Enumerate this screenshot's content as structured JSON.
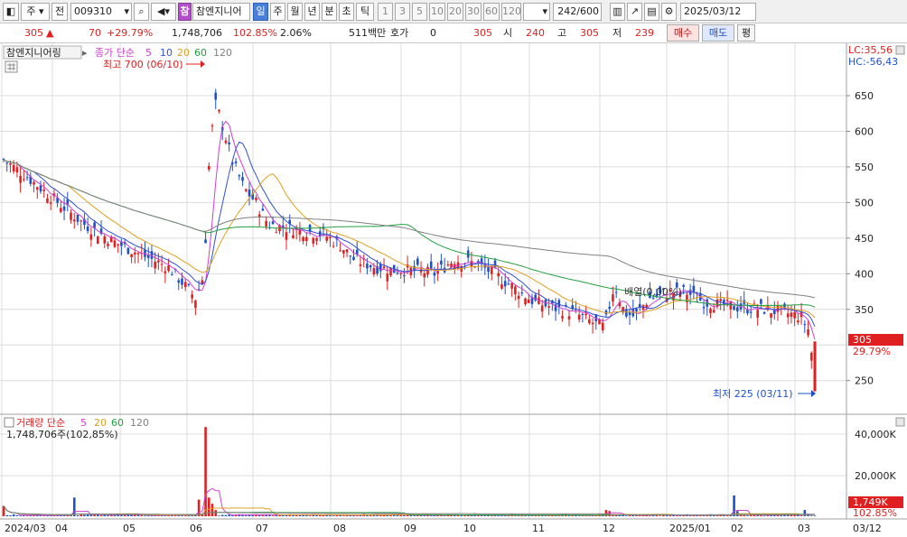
{
  "toolbar": {
    "type_label": "주",
    "jeon_label": "전",
    "code_value": "009310",
    "stock_name": "참엔지니어",
    "logo_char": "참",
    "periods": [
      "일",
      "주",
      "월",
      "년",
      "분",
      "초",
      "틱"
    ],
    "selected_period": "일",
    "counts": [
      "1",
      "3",
      "5",
      "10",
      "20",
      "30",
      "60",
      "120"
    ],
    "range_value": "242",
    "range_total": "/600",
    "date_value": "2025/03/12"
  },
  "quote": {
    "price": "305",
    "change": "70",
    "change_pct": "+29.79%",
    "volume": "1,748,706",
    "volume_ratio": "102.85%",
    "turnover": "2.06%",
    "amount": "511백만",
    "hoga_label": "호가",
    "hoga_value": "0",
    "hoga_price": "305",
    "open_label": "시",
    "open": "240",
    "high_label": "고",
    "high": "305",
    "low_label": "저",
    "low": "239",
    "buy_label": "매수",
    "sell_label": "매도",
    "eval_label": "평"
  },
  "price_panel": {
    "name_label": "참엔지니어링",
    "ma_label": "종가 단순",
    "ma_periods": [
      "5",
      "10",
      "20",
      "60",
      "120"
    ],
    "ma_colors": [
      "#d040d0",
      "#3050d0",
      "#e0a020",
      "#20a040",
      "#808080"
    ],
    "max_label": "최고 700 (06/10)",
    "min_label": "최저 225 (03/11)",
    "annotation": "배열(0,00%)",
    "lc": "LC:35,56",
    "hc": "HC:-56,43",
    "current_price_tag": "305",
    "current_pct": "29.79%",
    "y_ticks": [
      "650",
      "600",
      "550",
      "500",
      "450",
      "400",
      "350",
      "250"
    ]
  },
  "volume_panel": {
    "title": "거래량 단순",
    "ma_periods": [
      "5",
      "20",
      "60",
      "120"
    ],
    "value_text": "1,748,706주(102,85%)",
    "y_ticks": [
      "40,000K",
      "20,000K"
    ],
    "current_tag": "1,749K",
    "current_pct": "102.85%"
  },
  "x_axis": {
    "labels": [
      "2024/03",
      "04",
      "05",
      "06",
      "07",
      "08",
      "09",
      "10",
      "11",
      "12",
      "2025/01",
      "02",
      "03",
      "03/12"
    ]
  },
  "colors": {
    "up": "#e02020",
    "down": "#1e50c8",
    "grid": "#d8d8d8"
  }
}
